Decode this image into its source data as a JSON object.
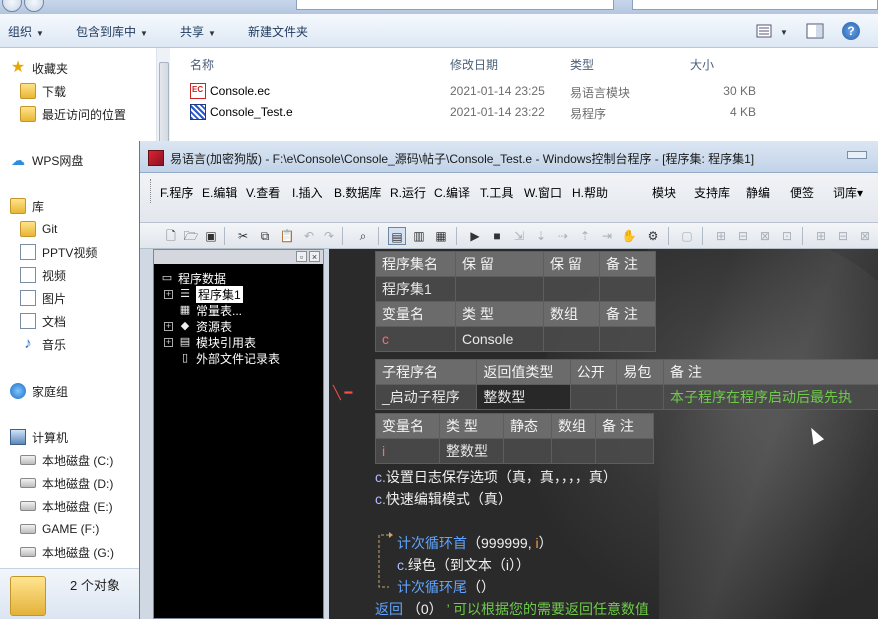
{
  "explorer": {
    "toolbar": {
      "organize": "组织",
      "include_in_library": "包含到库中",
      "share": "共享",
      "new_folder": "新建文件夹"
    },
    "nav": {
      "favorites": "收藏夹",
      "downloads": "下载",
      "recent": "最近访问的位置",
      "wps": "WPS网盘",
      "libraries": "库",
      "git": "Git",
      "pptv": "PPTV视频",
      "videos": "视频",
      "pictures": "图片",
      "documents": "文档",
      "music": "音乐",
      "homegroup": "家庭组",
      "computer": "计算机",
      "drive_c": "本地磁盘 (C:)",
      "drive_d": "本地磁盘 (D:)",
      "drive_e": "本地磁盘 (E:)",
      "drive_f": "GAME (F:)",
      "drive_g": "本地磁盘 (G:)"
    },
    "columns": {
      "name": "名称",
      "date": "修改日期",
      "type": "类型",
      "size": "大小"
    },
    "files": [
      {
        "name": "Console.ec",
        "date": "2021-01-14 23:25",
        "type": "易语言模块",
        "size": "30 KB"
      },
      {
        "name": "Console_Test.e",
        "date": "2021-01-14 23:22",
        "type": "易程序",
        "size": "4 KB"
      }
    ],
    "status": "2 个对象"
  },
  "ide": {
    "title": "易语言(加密狗版) - F:\\e\\Console\\Console_源码\\帖子\\Console_Test.e - Windows控制台程序 - [程序集: 程序集1]",
    "menu": {
      "program": "F.程序",
      "edit": "E.编辑",
      "view": "V.查看",
      "insert": "I.插入",
      "database": "B.数据库",
      "run": "R.运行",
      "compile": "C.编译",
      "tools": "T.工具",
      "window": "W.窗口",
      "help": "H.帮助",
      "module": "模块",
      "support_lib": "支持库",
      "static_compile": "静编",
      "convenient": "便签",
      "lexicon": "词库▾"
    },
    "tree": {
      "root": "程序数据",
      "assembly": "程序集1",
      "constants": "常量表...",
      "resources": "资源表",
      "module_refs": "模块引用表",
      "external_files": "外部文件记录表"
    },
    "code": {
      "asm_header": [
        "程序集名",
        "保 留",
        "保 留",
        "备 注"
      ],
      "asm_name": "程序集1",
      "var_header": [
        "变量名",
        "类 型",
        "数组",
        "备 注"
      ],
      "var_name": "c",
      "var_type": "Console",
      "sub_header": [
        "子程序名",
        "返回值类型",
        "公开",
        "易包",
        "备 注"
      ],
      "sub_name": "_启动子程序",
      "sub_return": "整数型",
      "sub_comment": "本子程序在程序启动后最先执",
      "local_header": [
        "变量名",
        "类 型",
        "静态",
        "数组",
        "备 注"
      ],
      "local_name": "i",
      "local_type": "整数型",
      "line1_prefix": "c.",
      "line1": "设置日志保存选项（真，真，，，，真）",
      "line2_prefix": "c.",
      "line2": "快速编辑模式（真）",
      "loop_kw": "计次循环首",
      "loop_args_a": "（999999, ",
      "loop_var": "i",
      "loop_args_b": "）",
      "inner_prefix": "c.",
      "inner": "绿色（到文本（i））",
      "loop_end_kw": "计次循环尾",
      "loop_end_args": "（）",
      "return_kw": "返回",
      "return_args": "（0）",
      "return_comment": "’ 可以根据您的需要返回任意数值"
    }
  }
}
